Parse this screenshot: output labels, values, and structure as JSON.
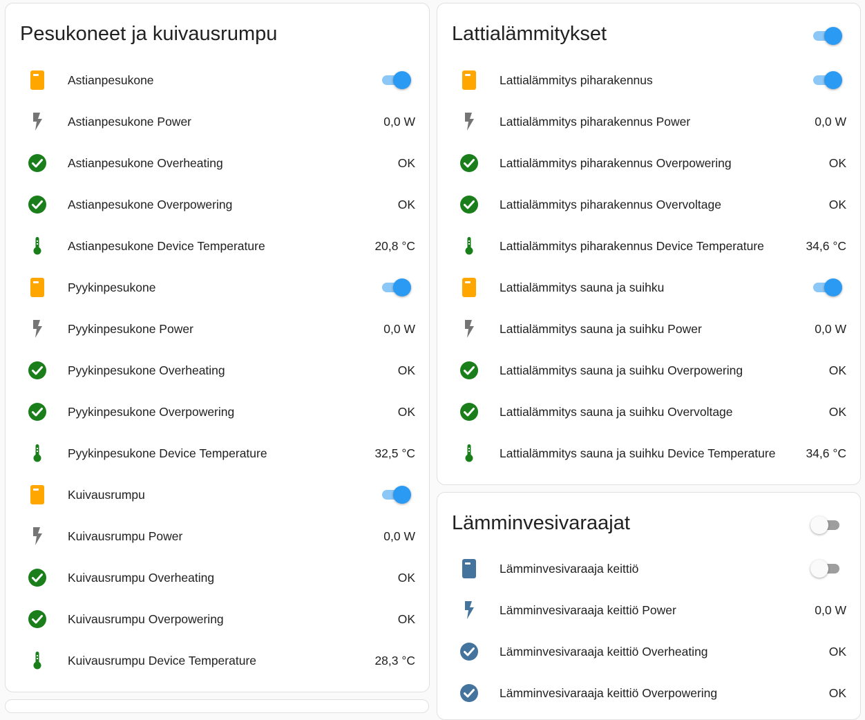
{
  "colors": {
    "switch_icon": "#FFA600",
    "switch_icon_off": "#44739E",
    "power_icon": "#757575",
    "power_icon_active": "#44739E",
    "check_icon": "#1A7F1A",
    "check_icon_off": "#44739E",
    "thermo_icon": "#1A7F1A",
    "toggle_on": "#2B9AF3"
  },
  "cards": [
    {
      "title": "Pesukoneet ja kuivausrumpu",
      "rows": [
        {
          "icon": "appliance-icon",
          "name": "Astianpesukone",
          "toggle": true
        },
        {
          "icon": "lightning-icon",
          "name": "Astianpesukone Power",
          "state": "0,0 W"
        },
        {
          "icon": "check-circle-icon",
          "name": "Astianpesukone Overheating",
          "state": "OK"
        },
        {
          "icon": "check-circle-icon",
          "name": "Astianpesukone Overpowering",
          "state": "OK"
        },
        {
          "icon": "thermometer-icon",
          "name": "Astianpesukone Device Temperature",
          "state": "20,8 °C"
        },
        {
          "icon": "appliance-icon",
          "name": "Pyykinpesukone",
          "toggle": true
        },
        {
          "icon": "lightning-icon",
          "name": "Pyykinpesukone Power",
          "state": "0,0 W"
        },
        {
          "icon": "check-circle-icon",
          "name": "Pyykinpesukone Overheating",
          "state": "OK"
        },
        {
          "icon": "check-circle-icon",
          "name": "Pyykinpesukone Overpowering",
          "state": "OK"
        },
        {
          "icon": "thermometer-icon",
          "name": "Pyykinpesukone Device Temperature",
          "state": "32,5 °C"
        },
        {
          "icon": "appliance-icon",
          "name": "Kuivausrumpu",
          "toggle": true
        },
        {
          "icon": "lightning-icon",
          "name": "Kuivausrumpu Power",
          "state": "0,0 W"
        },
        {
          "icon": "check-circle-icon",
          "name": "Kuivausrumpu Overheating",
          "state": "OK"
        },
        {
          "icon": "check-circle-icon",
          "name": "Kuivausrumpu Overpowering",
          "state": "OK"
        },
        {
          "icon": "thermometer-icon",
          "name": "Kuivausrumpu Device Temperature",
          "state": "28,3 °C"
        }
      ]
    },
    {
      "title": "Lattialämmitykset",
      "header_toggle": true,
      "rows": [
        {
          "icon": "appliance-icon",
          "name": "Lattialämmitys piharakennus",
          "toggle": true
        },
        {
          "icon": "lightning-icon",
          "name": "Lattialämmitys piharakennus Power",
          "state": "0,0 W"
        },
        {
          "icon": "check-circle-icon",
          "name": "Lattialämmitys piharakennus Overpowering",
          "state": "OK"
        },
        {
          "icon": "check-circle-icon",
          "name": "Lattialämmitys piharakennus Overvoltage",
          "state": "OK"
        },
        {
          "icon": "thermometer-icon",
          "name": "Lattialämmitys piharakennus Device Temperature",
          "state": "34,6 °C"
        },
        {
          "icon": "appliance-icon",
          "name": "Lattialämmitys sauna ja suihku",
          "toggle": true
        },
        {
          "icon": "lightning-icon",
          "name": "Lattialämmitys sauna ja suihku Power",
          "state": "0,0 W"
        },
        {
          "icon": "check-circle-icon",
          "name": "Lattialämmitys sauna ja suihku Overpowering",
          "state": "OK"
        },
        {
          "icon": "check-circle-icon",
          "name": "Lattialämmitys sauna ja suihku Overvoltage",
          "state": "OK"
        },
        {
          "icon": "thermometer-icon",
          "name": "Lattialämmitys sauna ja suihku Device Temperature",
          "state": "34,6 °C"
        }
      ]
    },
    {
      "title": "Lämminvesivaraajat",
      "header_toggle": false,
      "rows": [
        {
          "icon": "appliance-icon",
          "name": "Lämminvesivaraaja keittiö",
          "toggle": false
        },
        {
          "icon": "lightning-icon",
          "name": "Lämminvesivaraaja keittiö Power",
          "state": "0,0 W"
        },
        {
          "icon": "check-circle-icon",
          "name": "Lämminvesivaraaja keittiö Overheating",
          "state": "OK"
        },
        {
          "icon": "check-circle-icon",
          "name": "Lämminvesivaraaja keittiö Overpowering",
          "state": "OK"
        }
      ]
    }
  ]
}
